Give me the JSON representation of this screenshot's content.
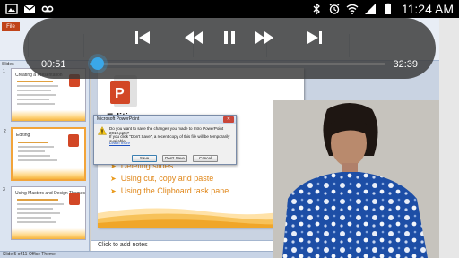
{
  "status_bar": {
    "time": "11:24 AM",
    "left_icons": [
      "image-icon",
      "mail-icon",
      "voicemail-icon"
    ],
    "right_icons": [
      "bluetooth-icon",
      "alarm-icon",
      "wifi-icon",
      "signal-icon",
      "battery-icon"
    ]
  },
  "player": {
    "current_time": "00:51",
    "total_time": "32:39",
    "progress": 0.026,
    "accent_color": "#3aa7e8",
    "controls": [
      "skip-previous-icon",
      "rewind-icon",
      "pause-icon",
      "fast-forward-icon",
      "skip-next-icon"
    ]
  },
  "powerpoint": {
    "file_tab": "File",
    "pane_header": "Slides",
    "thumbnails": [
      {
        "number": "1",
        "title": "Creating a Presentation"
      },
      {
        "number": "2",
        "title": "Editing"
      },
      {
        "number": "3",
        "title": "Using Masters and Design Themes"
      }
    ],
    "slide": {
      "title": "Editing",
      "bullets": [
        "Deleting slides",
        "Using cut, copy and paste",
        "Using the Clipboard task pane"
      ]
    },
    "notes_placeholder": "Click to add notes",
    "status_slide": "Slide 5 of 11",
    "status_theme": "Office Theme",
    "dialog": {
      "title": "Microsoft PowerPoint",
      "question": "Do you want to save the changes you made to Intro PowerPoint 2010.pptx?",
      "note": "If you click \"Don't Save\", a recent copy of this file will be temporarily available.",
      "link": "Learn more",
      "buttons": [
        "Save",
        "Don't Save",
        "Cancel"
      ]
    }
  }
}
